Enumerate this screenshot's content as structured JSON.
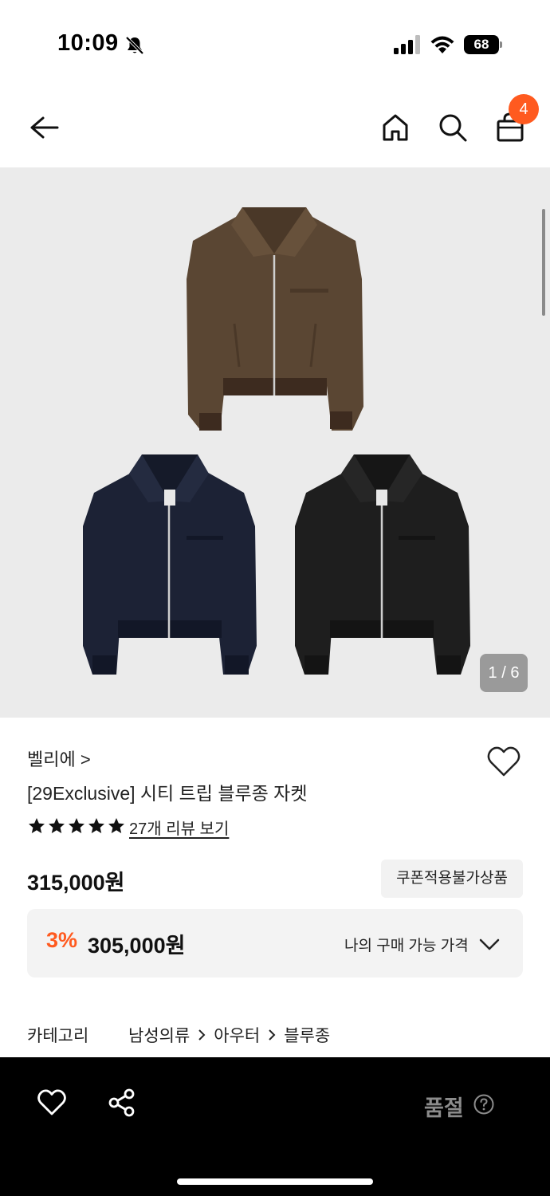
{
  "status_bar": {
    "time": "10:09",
    "battery": "68"
  },
  "header": {
    "cart_count": "4"
  },
  "gallery": {
    "page_indicator": "1 / 6",
    "current_page": 1,
    "total_pages": 6
  },
  "product": {
    "brand": "벨리에 >",
    "title": "[29Exclusive] 시티 트립 블루종 자켓",
    "rating_stars": 5,
    "review_link": "27개 리뷰 보기",
    "price": "315,000원",
    "coupon_label": "쿠폰적용불가상품",
    "discount_rate": "3%",
    "discount_price": "305,000원",
    "my_price_label": "나의 구매 가능 가격"
  },
  "category": {
    "label": "카테고리",
    "path": [
      "남성의류",
      "아우터",
      "블루종"
    ]
  },
  "bottom_bar": {
    "soldout_label": "품절"
  },
  "colors": {
    "accent": "#ff5a1f",
    "gallery_bg": "#ebebeb",
    "jacket_brown": "#5a4633",
    "jacket_navy": "#1c2235",
    "jacket_black": "#1e1e1e"
  }
}
